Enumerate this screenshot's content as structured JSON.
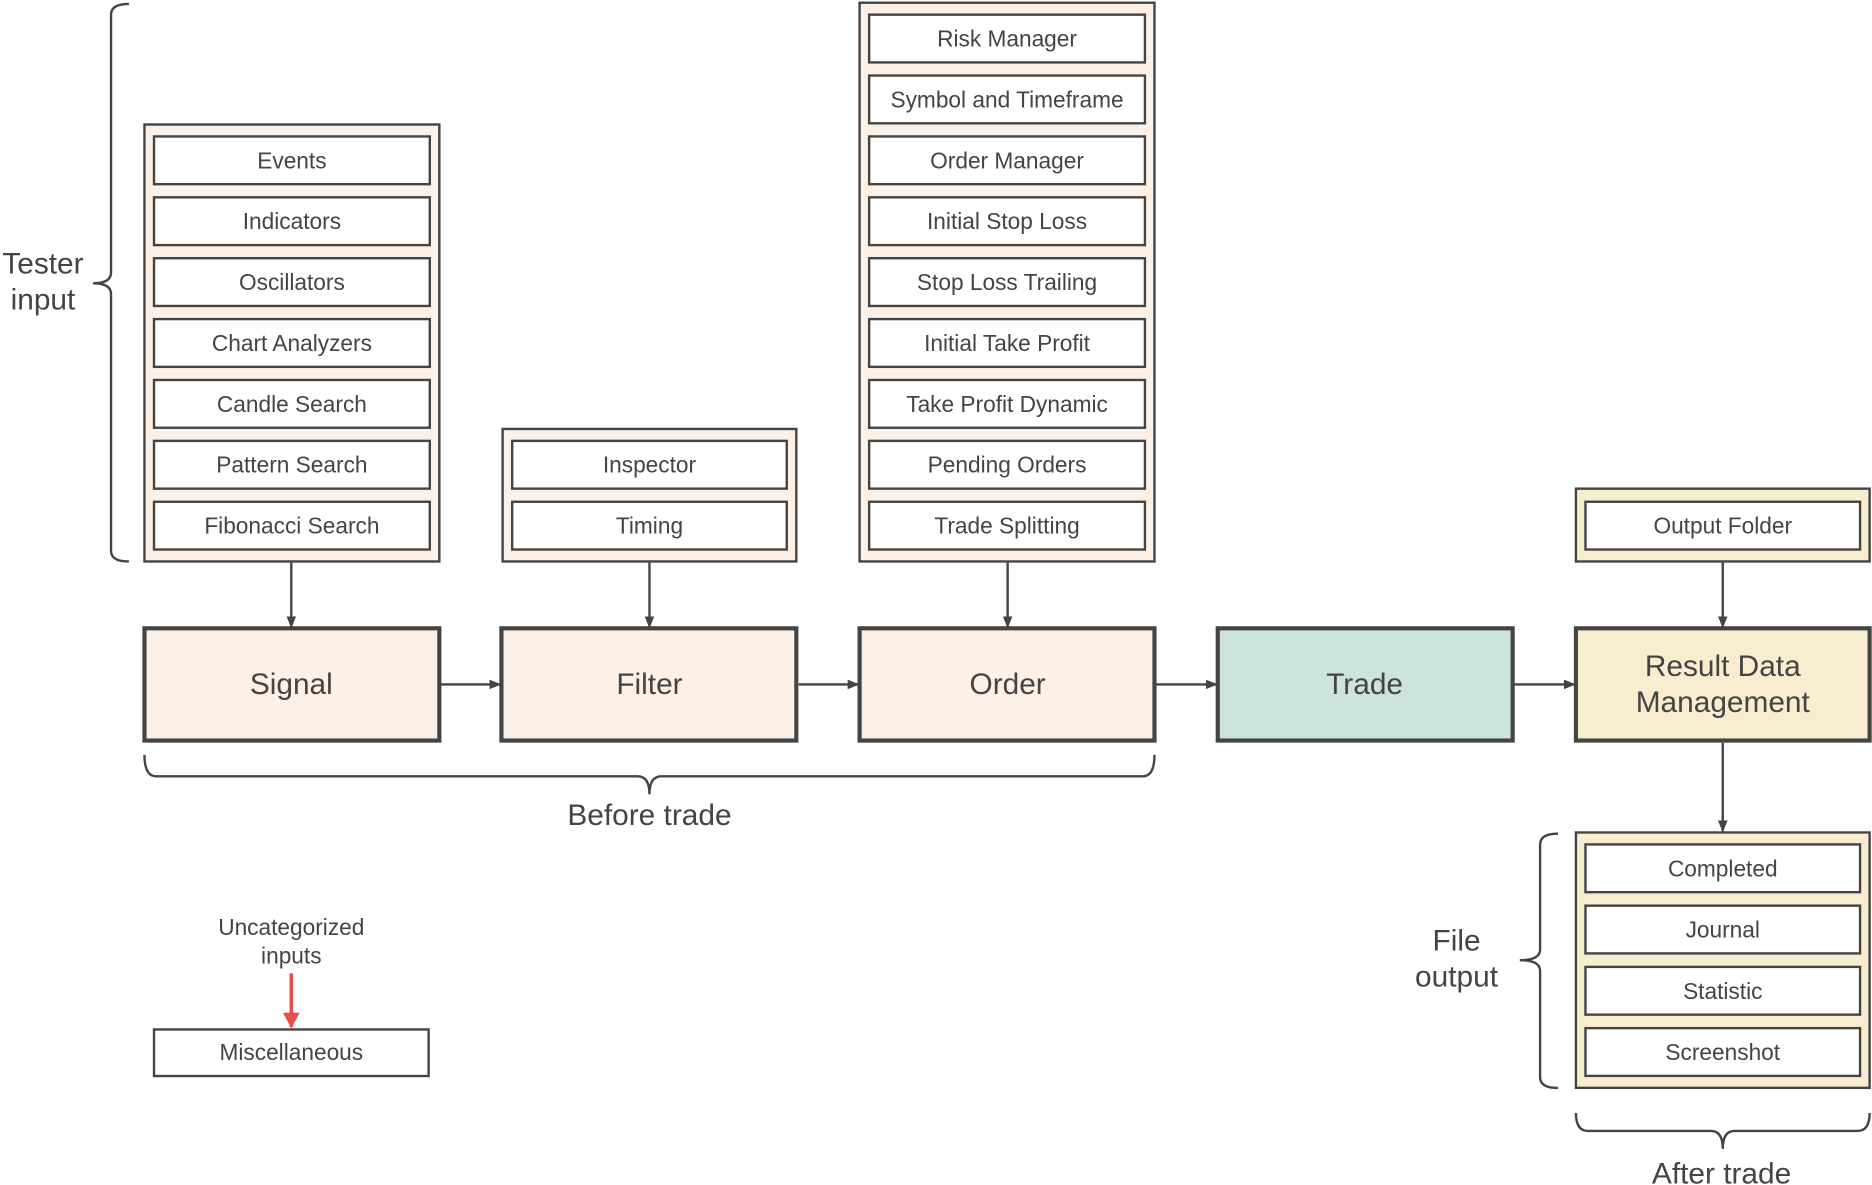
{
  "colors": {
    "stroke": "#444444",
    "peach": "#fdf0e6",
    "teal": "#cde3dd",
    "yellow": "#f8edcf",
    "item_fill": "#ffffff",
    "red_arrow": "#e84c4c"
  },
  "groups": {
    "signal": {
      "items": [
        "Events",
        "Indicators",
        "Oscillators",
        "Chart Analyzers",
        "Candle Search",
        "Pattern Search",
        "Fibonacci Search"
      ]
    },
    "filter": {
      "items": [
        "Inspector",
        "Timing"
      ]
    },
    "order": {
      "items": [
        "Risk Manager",
        "Symbol and Timeframe",
        "Order Manager",
        "Initial Stop Loss",
        "Stop Loss Trailing",
        "Initial Take Profit",
        "Take Profit Dynamic",
        "Pending Orders",
        "Trade Splitting"
      ]
    },
    "output_folder": {
      "items": [
        "Output Folder"
      ]
    },
    "file_output": {
      "items": [
        "Completed",
        "Journal",
        "Statistic",
        "Screenshot"
      ]
    }
  },
  "stages": {
    "signal": "Signal",
    "filter": "Filter",
    "order": "Order",
    "trade": "Trade",
    "result_line1": "Result Data",
    "result_line2": "Management"
  },
  "labels": {
    "tester_input_1": "Tester",
    "tester_input_2": "input",
    "before_trade": "Before trade",
    "file_output_1": "File",
    "file_output_2": "output",
    "after_trade": "After trade",
    "uncategorized_1": "Uncategorized",
    "uncategorized_2": "inputs",
    "miscellaneous": "Miscellaneous"
  }
}
